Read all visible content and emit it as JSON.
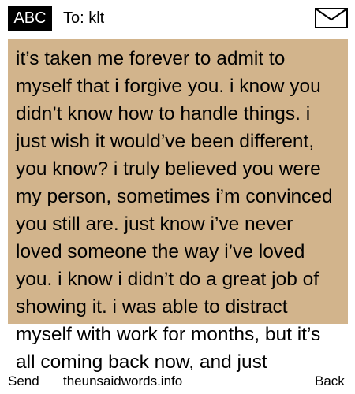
{
  "header": {
    "input_mode": "ABC",
    "to_field": "To: klt"
  },
  "message": {
    "body": "it’s taken me forever to admit to myself that i forgive you. i know you didn’t know how to handle things. i just wish it would’ve been different, you know? i truly believed you were my person, sometimes i’m convinced you still are. just know i’ve never loved someone the way i’ve loved you. i know i didn’t do a great job of showing it. i was able to distract myself with work for months, but it’s all coming back now, and just"
  },
  "footer": {
    "send_label": "Send",
    "site_label": "theunsaidwords.info",
    "back_label": "Back"
  },
  "colors": {
    "message_background": "#d2b48c",
    "badge_background": "#000000"
  },
  "icons": {
    "header_right": "envelope-icon"
  }
}
